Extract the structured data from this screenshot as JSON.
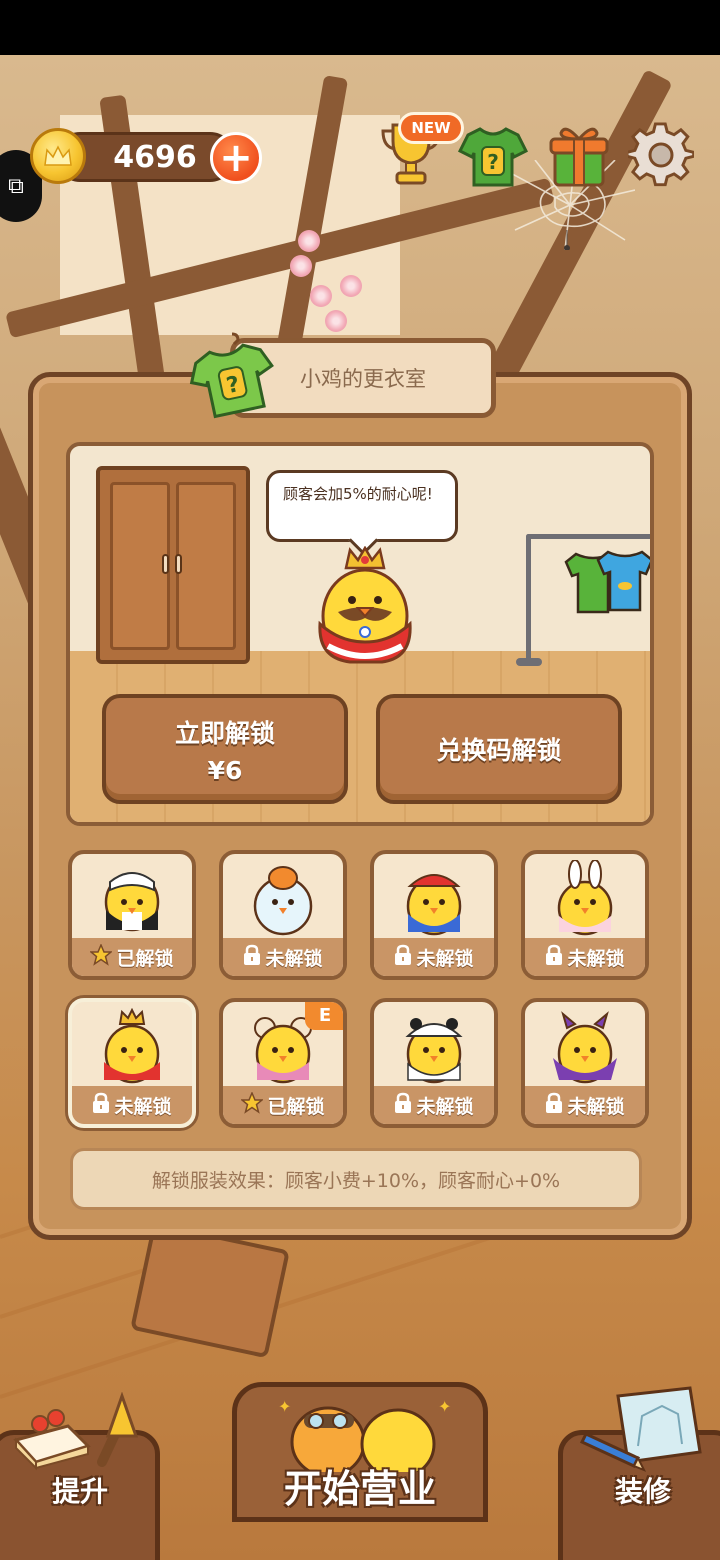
{
  "hud": {
    "coins": "4696",
    "plus_icon": "plus-icon",
    "new_badge": "NEW",
    "icons": [
      "trophy-icon",
      "mystery-shirt-icon",
      "gift-icon",
      "gear-icon"
    ]
  },
  "panel": {
    "title": "小鸡的更衣室",
    "speech": "顾客会加5%的耐心呢!",
    "unlock_button": {
      "line1": "立即解锁",
      "line2": "¥6"
    },
    "redeem_button": "兑换码解锁",
    "costumes": [
      {
        "status": "已解锁",
        "locked": false,
        "badge": ""
      },
      {
        "status": "未解锁",
        "locked": true,
        "badge": ""
      },
      {
        "status": "未解锁",
        "locked": true,
        "badge": ""
      },
      {
        "status": "未解锁",
        "locked": true,
        "badge": ""
      },
      {
        "status": "未解锁",
        "locked": true,
        "badge": "",
        "selected": true
      },
      {
        "status": "已解锁",
        "locked": false,
        "badge": "E"
      },
      {
        "status": "未解锁",
        "locked": true,
        "badge": ""
      },
      {
        "status": "未解锁",
        "locked": true,
        "badge": ""
      }
    ],
    "effect": "解锁服装效果：顾客小费+10%，顾客耐心+0%"
  },
  "bottom_nav": {
    "upgrade": "提升",
    "start": "开始营业",
    "decorate": "装修"
  },
  "colors": {
    "panel_wood": "#c7935c",
    "panel_border": "#6f4426",
    "button": "#b8794a",
    "accent_orange": "#f0501e",
    "coin_gold": "#f7c531"
  }
}
